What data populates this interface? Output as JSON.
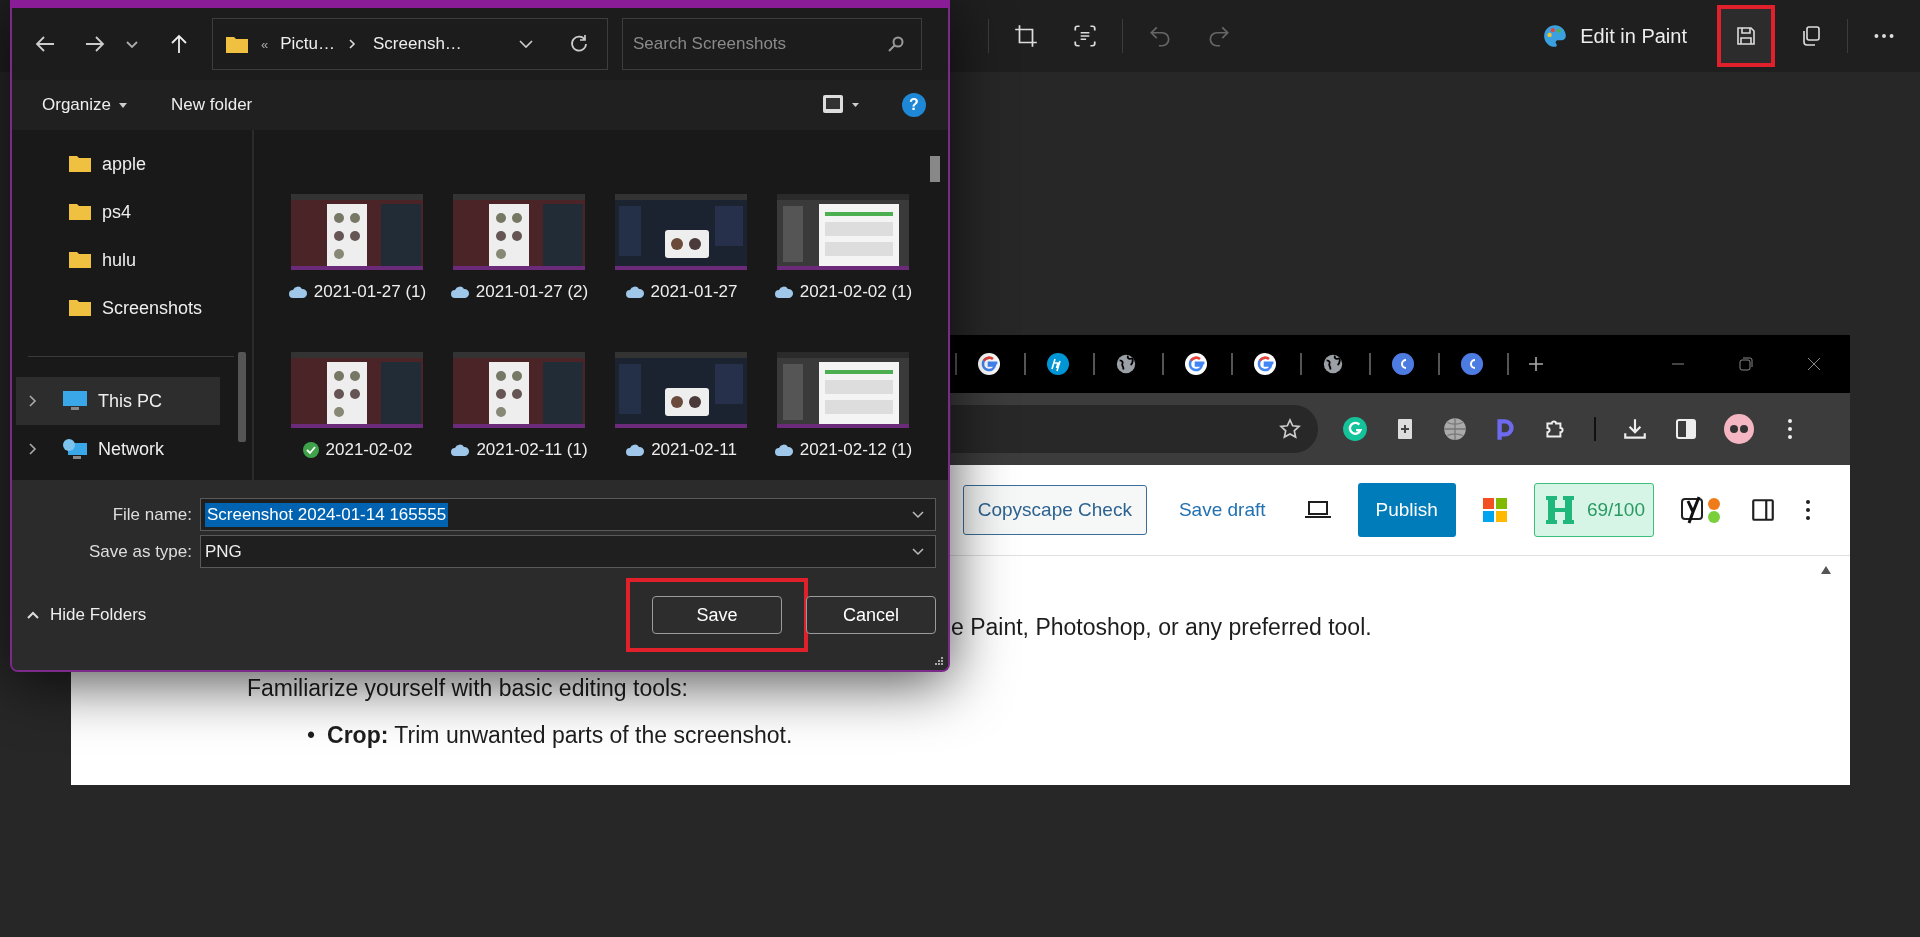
{
  "photos_toolbar": {
    "undo": {
      "disabled": true
    },
    "redo": {
      "disabled": true
    },
    "edit_button": "Edit in Paint",
    "save": {
      "highlighted": true
    }
  },
  "browser": {
    "tabs": [
      {
        "kind": "google"
      },
      {
        "kind": "hp"
      },
      {
        "kind": "globe"
      },
      {
        "kind": "google"
      },
      {
        "kind": "google"
      },
      {
        "kind": "globe"
      },
      {
        "kind": "canva"
      },
      {
        "kind": "canva"
      }
    ],
    "extensions": [
      {
        "kind": "grammarly"
      },
      {
        "kind": "doc"
      },
      {
        "kind": "globe"
      },
      {
        "kind": "d"
      },
      {
        "kind": "puzzle"
      }
    ]
  },
  "editor_toolbar": {
    "copyscape": "Copyscape Check",
    "save_draft": "Save draft",
    "publish": "Publish",
    "seo_score": "69/100"
  },
  "content": {
    "line_1": "e Paint, Photoshop, or any preferred tool.",
    "line_2": "Familiarize yourself with basic editing tools:",
    "bullets": [
      {
        "marker": "•",
        "text": "**Crop:** Trim unwanted parts of the screenshot."
      }
    ]
  },
  "dialog": {
    "address": [
      "«",
      "Pictu…",
      "Screensh…"
    ],
    "search": {
      "placeholder": "Search Screenshots"
    },
    "commands": [
      {
        "label": "Organize",
        "dropdown": true
      },
      {
        "label": "New folder",
        "dropdown": false
      }
    ],
    "help": "?",
    "nav_items": [
      {
        "label": "apple",
        "kind": "folder",
        "expandable": false,
        "selected": false
      },
      {
        "label": "ps4",
        "kind": "folder",
        "expandable": false,
        "selected": false
      },
      {
        "label": "hulu",
        "kind": "folder",
        "expandable": false,
        "selected": false
      },
      {
        "label": "Screenshots",
        "kind": "folder",
        "expandable": false,
        "selected": false
      },
      {
        "label": "This PC",
        "kind": "pc",
        "expandable": true,
        "selected": true
      },
      {
        "label": "Network",
        "kind": "network",
        "expandable": true,
        "selected": false
      }
    ],
    "files": [
      {
        "name": "2021-01-27 (1)",
        "kind": "cloud"
      },
      {
        "name": "2021-01-27 (2)",
        "kind": "cloud"
      },
      {
        "name": "2021-01-27",
        "kind": "cloud"
      },
      {
        "name": "2021-02-02 (1)",
        "kind": "cloud"
      },
      {
        "name": "2021-02-02",
        "kind": "local"
      },
      {
        "name": "2021-02-11 (1)",
        "kind": "cloud"
      },
      {
        "name": "2021-02-11",
        "kind": "cloud"
      },
      {
        "name": "2021-02-12 (1)",
        "kind": "cloud"
      }
    ],
    "file_name": {
      "label": "File name:",
      "value": "Screenshot 2024-01-14 165555"
    },
    "save_as_type": {
      "label": "Save as type:",
      "value": "PNG"
    },
    "hide_folders": "Hide Folders",
    "save": {
      "label": "Save",
      "highlighted": true
    },
    "cancel": "Cancel"
  }
}
